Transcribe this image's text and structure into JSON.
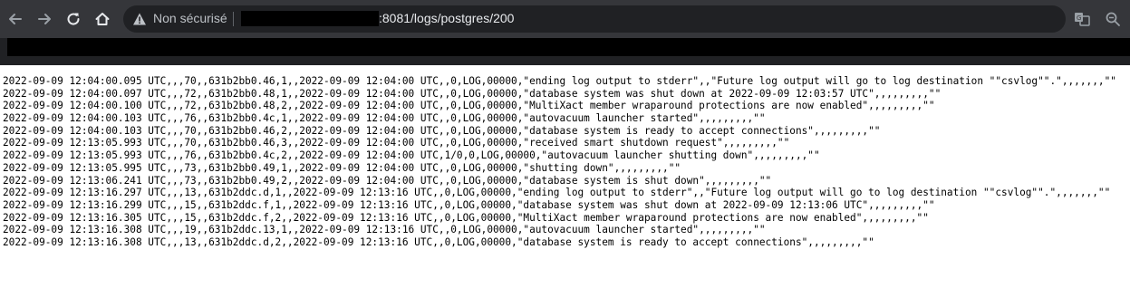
{
  "browser": {
    "security_label": "Non sécurisé",
    "url_visible": ":8081/logs/postgres/200",
    "icons": {
      "back": "back-arrow-icon",
      "forward": "forward-arrow-icon",
      "reload": "reload-icon",
      "home": "home-icon",
      "security": "warning-triangle-icon",
      "translate": "translate-icon",
      "zoom": "zoom-out-icon"
    }
  },
  "colors": {
    "toolbar_bg": "#35363a",
    "omnibox_bg": "#202124",
    "page_bg": "#ffffff",
    "text": "#000000"
  },
  "log": {
    "lines": [
      "2022-09-09 12:04:00.095 UTC,,,70,,631b2bb0.46,1,,2022-09-09 12:04:00 UTC,,0,LOG,00000,\"ending log output to stderr\",,\"Future log output will go to log destination \"\"csvlog\"\".\",,,,,,,\"\"",
      "2022-09-09 12:04:00.097 UTC,,,72,,631b2bb0.48,1,,2022-09-09 12:04:00 UTC,,0,LOG,00000,\"database system was shut down at 2022-09-09 12:03:57 UTC\",,,,,,,,,\"\"",
      "2022-09-09 12:04:00.100 UTC,,,72,,631b2bb0.48,2,,2022-09-09 12:04:00 UTC,,0,LOG,00000,\"MultiXact member wraparound protections are now enabled\",,,,,,,,,\"\"",
      "2022-09-09 12:04:00.103 UTC,,,76,,631b2bb0.4c,1,,2022-09-09 12:04:00 UTC,,0,LOG,00000,\"autovacuum launcher started\",,,,,,,,,\"\"",
      "2022-09-09 12:04:00.103 UTC,,,70,,631b2bb0.46,2,,2022-09-09 12:04:00 UTC,,0,LOG,00000,\"database system is ready to accept connections\",,,,,,,,,\"\"",
      "2022-09-09 12:13:05.993 UTC,,,70,,631b2bb0.46,3,,2022-09-09 12:04:00 UTC,,0,LOG,00000,\"received smart shutdown request\",,,,,,,,,\"\"",
      "2022-09-09 12:13:05.993 UTC,,,76,,631b2bb0.4c,2,,2022-09-09 12:04:00 UTC,1/0,0,LOG,00000,\"autovacuum launcher shutting down\",,,,,,,,,\"\"",
      "2022-09-09 12:13:05.995 UTC,,,73,,631b2bb0.49,1,,2022-09-09 12:04:00 UTC,,0,LOG,00000,\"shutting down\",,,,,,,,,\"\"",
      "2022-09-09 12:13:06.241 UTC,,,73,,631b2bb0.49,2,,2022-09-09 12:04:00 UTC,,0,LOG,00000,\"database system is shut down\",,,,,,,,,\"\"",
      "2022-09-09 12:13:16.297 UTC,,,13,,631b2ddc.d,1,,2022-09-09 12:13:16 UTC,,0,LOG,00000,\"ending log output to stderr\",,\"Future log output will go to log destination \"\"csvlog\"\".\",,,,,,,\"\"",
      "2022-09-09 12:13:16.299 UTC,,,15,,631b2ddc.f,1,,2022-09-09 12:13:16 UTC,,0,LOG,00000,\"database system was shut down at 2022-09-09 12:13:06 UTC\",,,,,,,,,\"\"",
      "2022-09-09 12:13:16.305 UTC,,,15,,631b2ddc.f,2,,2022-09-09 12:13:16 UTC,,0,LOG,00000,\"MultiXact member wraparound protections are now enabled\",,,,,,,,,\"\"",
      "2022-09-09 12:13:16.308 UTC,,,19,,631b2ddc.13,1,,2022-09-09 12:13:16 UTC,,0,LOG,00000,\"autovacuum launcher started\",,,,,,,,,\"\"",
      "2022-09-09 12:13:16.308 UTC,,,13,,631b2ddc.d,2,,2022-09-09 12:13:16 UTC,,0,LOG,00000,\"database system is ready to accept connections\",,,,,,,,,\"\""
    ]
  }
}
